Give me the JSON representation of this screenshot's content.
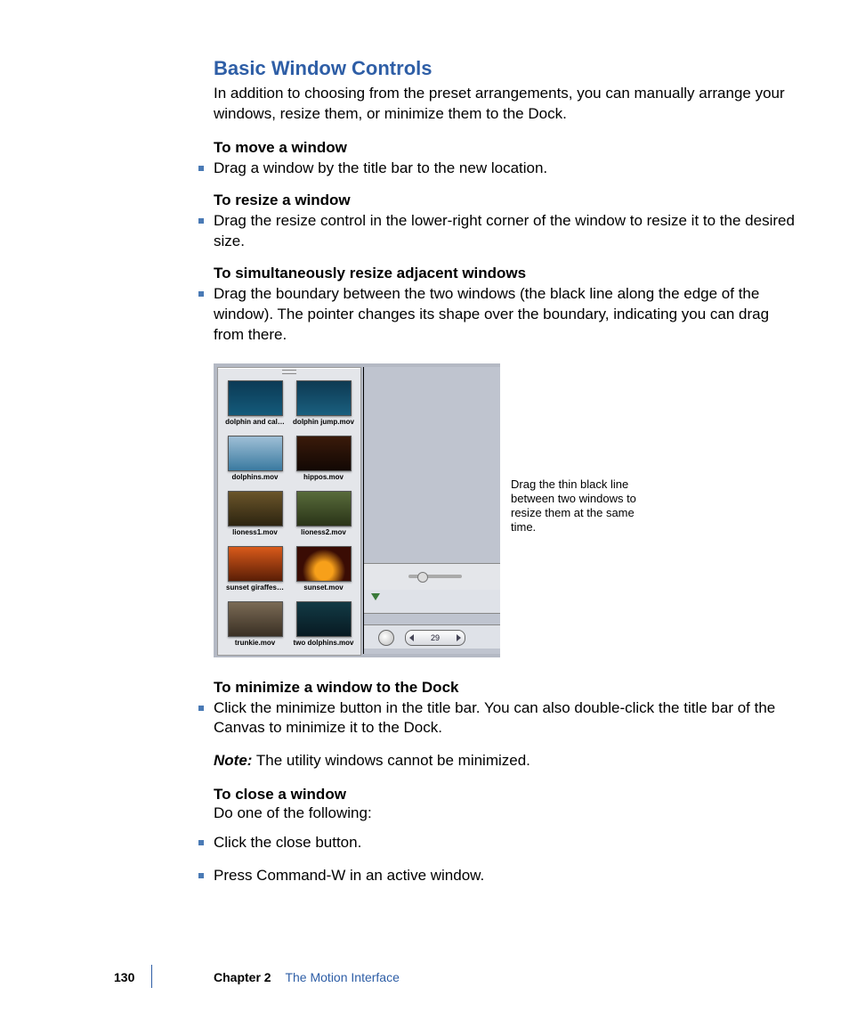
{
  "heading": "Basic Window Controls",
  "intro": "In addition to choosing from the preset arrangements, you can manually arrange your windows, resize them, or minimize them to the Dock.",
  "s1": {
    "head": "To move a window",
    "b1": "Drag a window by the title bar to the new location."
  },
  "s2": {
    "head": "To resize a window",
    "b1": "Drag the resize control in the lower-right corner of the window to resize it to the desired size."
  },
  "s3": {
    "head": "To simultaneously resize adjacent windows",
    "b1": "Drag the boundary between the two windows (the black line along the edge of the window). The pointer changes its shape over the boundary, indicating you can drag from there."
  },
  "callout": "Drag the thin black line between two windows to resize them at the same time.",
  "thumbs": [
    {
      "label": "dolphin and cal…",
      "bg": "linear-gradient(#0b3a55,#145a7a)"
    },
    {
      "label": "dolphin jump.mov",
      "bg": "linear-gradient(#0d3a52,#1a5f7f)"
    },
    {
      "label": "dolphins.mov",
      "bg": "linear-gradient(#9fbfd6,#3a7aa0)"
    },
    {
      "label": "hippos.mov",
      "bg": "linear-gradient(#3a1a0a,#120804)"
    },
    {
      "label": "lioness1.mov",
      "bg": "linear-gradient(#6a552a,#2d2410)"
    },
    {
      "label": "lioness2.mov",
      "bg": "linear-gradient(#586b3a,#2a3418)"
    },
    {
      "label": "sunset giraffes…",
      "bg": "linear-gradient(#d95a1a,#5a1e06)"
    },
    {
      "label": "sunset.mov",
      "bg": "radial-gradient(circle at 50% 70%, #f7a01a 25%, #3a0c04 60%)"
    },
    {
      "label": "trunkie.mov",
      "bg": "linear-gradient(#7a6a55,#3a3024)"
    },
    {
      "label": "two dolphins.mov",
      "bg": "linear-gradient(#123a45,#081a22)"
    }
  ],
  "counter": "29",
  "s4": {
    "head": "To minimize a window to the Dock",
    "b1": "Click the minimize button in the title bar. You can also double-click the title bar of the Canvas to minimize it to the Dock.",
    "note_label": "Note:",
    "note_body": "  The utility windows cannot be minimized."
  },
  "s5": {
    "head": "To close a window",
    "lead": "Do one of the following:",
    "b1": "Click the close button.",
    "b2": "Press Command-W in an active window."
  },
  "footer": {
    "page": "130",
    "chapter_label": "Chapter 2",
    "chapter_title": "The Motion Interface"
  }
}
